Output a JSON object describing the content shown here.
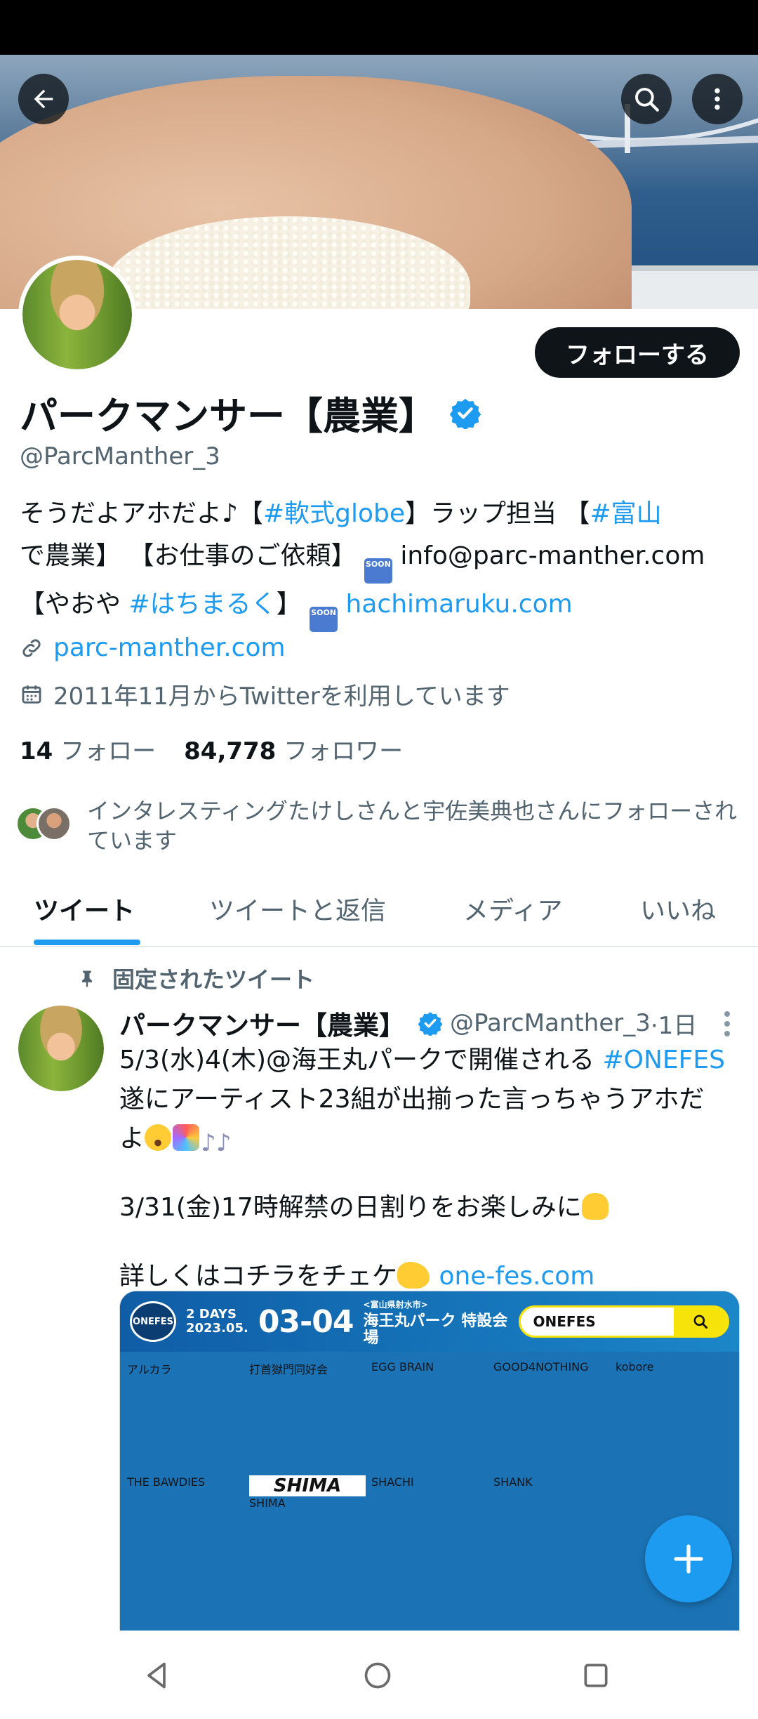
{
  "profile": {
    "display_name": "パークマンサー【農業】",
    "handle": "@ParcManther_3",
    "follow_label": "フォローする",
    "bio": {
      "line1_a": "そうだよアホだよ♪【",
      "line1_tag1": "#軟式globe",
      "line1_b": "】ラップ担当 【",
      "line1_tag2": "#富山",
      "line2_a": "で農業】 【お仕事のご依頼】",
      "line2_email": " info@parc-manther.com",
      "line3_a": "【やおや ",
      "line3_tag": "#はちまるく",
      "line3_b": "】",
      "line3_link": " hachimaruku.com",
      "soon_label": "SOON"
    },
    "website": "parc-manther.com",
    "joined": "2011年11月からTwitterを利用しています",
    "following_count": "14",
    "following_label": "フォロー",
    "followers_count": "84,778",
    "followers_label": "フォロワー",
    "followed_by": "インタレスティングたけしさんと宇佐美典也さんにフォローされています"
  },
  "tabs": [
    {
      "label": "ツイート",
      "active": true
    },
    {
      "label": "ツイートと返信",
      "active": false
    },
    {
      "label": "メディア",
      "active": false
    },
    {
      "label": "いいね",
      "active": false
    }
  ],
  "pinned_tweet": {
    "pinned_label": "固定されたツイート",
    "author_name": "パークマンサー【農業】",
    "author_handle": "@ParcManther_3",
    "time": "·1日",
    "text_line1_a": "5/3(水)4(木)@海王丸パークで開催される ",
    "text_line1_tag": "#ONEFES",
    "text_line2": "遂にアーティスト23組が出揃った言っちゃうアホだ",
    "text_line3": "よ",
    "text_para2": "3/31(金)17時解禁の日割りをお楽しみに",
    "text_para3_a": "詳しくはコチラをチェケ",
    "text_para3_link": " one-fes.com"
  },
  "card": {
    "logo_text": "ONEFES",
    "days": "2 DAYS",
    "year": "2023.05.",
    "dates": "03",
    "date_sep": "-04",
    "venue_small": "<富山県射水市>",
    "venue": "海王丸パーク 特設会場",
    "search_text": "ONEFES",
    "artists": [
      "アルカラ",
      "打首獄門同好会",
      "EGG BRAIN",
      "GOOD4NOTHING",
      "kobore",
      "THE BAWDIES",
      "SHIMA",
      "SHACHI",
      "SHANK",
      "",
      "",
      "",
      "",
      "",
      ""
    ],
    "shima_logo": "SHIMA"
  },
  "colors": {
    "accent": "#1d9bf0",
    "text_primary": "#0f1419",
    "text_secondary": "#536471",
    "button_dark": "#0f1419"
  },
  "icons": {
    "back": "arrow-left-icon",
    "search": "search-icon",
    "more": "more-vertical-icon",
    "verified": "verified-badge-icon",
    "link": "link-icon",
    "calendar": "calendar-icon",
    "pin": "pin-icon",
    "compose": "plus-icon",
    "nav_back": "triangle-back-icon",
    "nav_home": "circle-home-icon",
    "nav_recents": "square-recents-icon"
  }
}
